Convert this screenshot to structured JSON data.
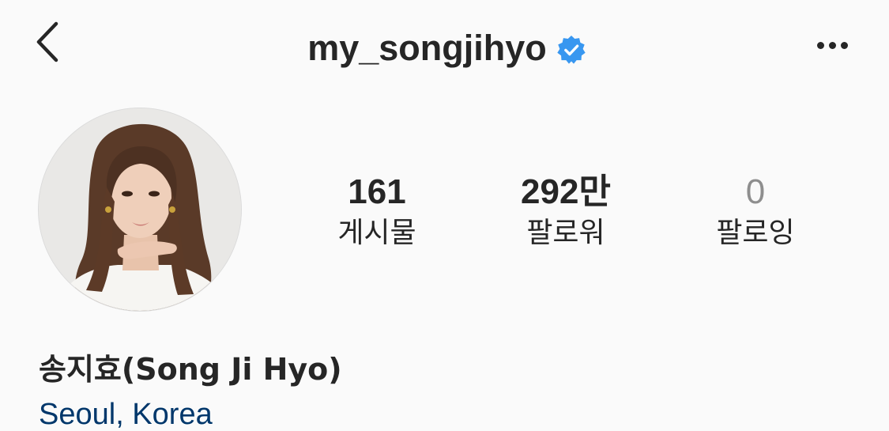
{
  "header": {
    "username": "my_songjihyo",
    "back_icon": "chevron-left-icon",
    "verified_icon": "verified-badge-icon",
    "more_icon": "more-horizontal-icon",
    "verified_color": "#3897f0"
  },
  "profile": {
    "avatar_icon": "profile-photo",
    "stats": [
      {
        "count": "161",
        "label": "게시물"
      },
      {
        "count": "292만",
        "label": "팔로워"
      },
      {
        "count": "0",
        "label": "팔로잉"
      }
    ],
    "full_name": "송지효(Song Ji Hyo)",
    "location": "Seoul, Korea",
    "location_color": "#00376b"
  }
}
